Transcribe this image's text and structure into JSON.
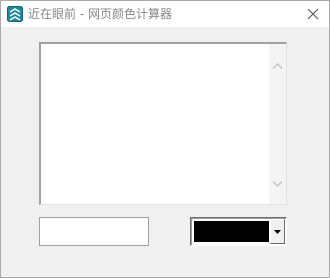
{
  "window": {
    "title": "近在眼前 - 网页颜色计算器",
    "app_icon": "app-logo-icon",
    "close_icon": "close-icon"
  },
  "color_list": {
    "items": [],
    "scroll_up_icon": "chevron-up-icon",
    "scroll_down_icon": "chevron-down-icon"
  },
  "value_input": {
    "value": "",
    "placeholder": ""
  },
  "color_select": {
    "selected_color": "#000000",
    "dropdown_icon": "triangle-down-icon"
  },
  "colors": {
    "window_bg": "#f0f0f0",
    "title_text": "#888888",
    "app_icon": "#1f8a9e"
  }
}
